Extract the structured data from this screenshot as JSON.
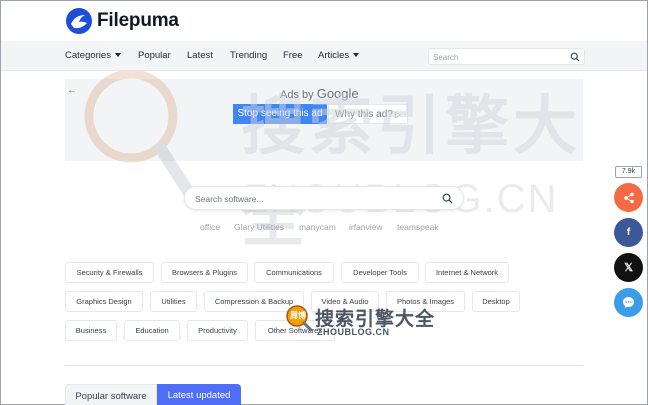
{
  "header": {
    "logo_text": "Filepuma"
  },
  "nav": {
    "items": [
      {
        "label": "Categories",
        "dropdown": true
      },
      {
        "label": "Popular",
        "dropdown": false
      },
      {
        "label": "Latest",
        "dropdown": false
      },
      {
        "label": "Trending",
        "dropdown": false
      },
      {
        "label": "Free",
        "dropdown": false
      },
      {
        "label": "Articles",
        "dropdown": true
      }
    ],
    "search_placeholder": "Search"
  },
  "ad": {
    "ads_by": "Ads by",
    "google": "Google",
    "stop_label": "Stop seeing this ad",
    "why_label": "Why this ad?",
    "why_icon": "play-icon"
  },
  "main_search": {
    "placeholder": "Search software..."
  },
  "suggestions": [
    "office",
    "Glary Utilities",
    "manycam",
    "irfanview",
    "teamspeak"
  ],
  "categories": [
    "Security & Firewalls",
    "Browsers & Plugins",
    "Communications",
    "Developer Tools",
    "Internet & Network",
    "Graphics Design",
    "Utilities",
    "Compression & Backup",
    "Video & Audio",
    "Photos & Images",
    "Desktop",
    "Business",
    "Education",
    "Productivity",
    "Other Softwares"
  ],
  "tabs": [
    {
      "label": "Popular software",
      "active": false
    },
    {
      "label": "Latest updated",
      "active": true
    }
  ],
  "share": {
    "count": "7.9k"
  },
  "watermark": {
    "main_text": "搜索引擎大全",
    "main_sub": "ZHOUBLOG.CN",
    "small_text": "搜索引擎大全",
    "small_sub": "ZHOUBLOG.CN",
    "badge_text": "周博"
  },
  "colors": {
    "accent": "#4f6ef5",
    "google_blue": "#4285f4",
    "share_orange": "#f26b45",
    "facebook": "#3b5998",
    "x_black": "#111111",
    "messenger": "#3b9de8"
  }
}
